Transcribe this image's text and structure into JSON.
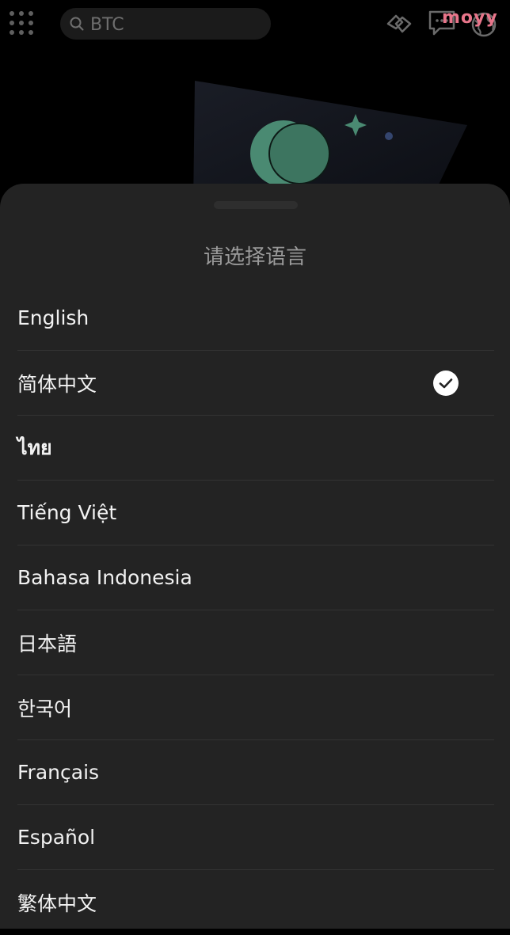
{
  "header": {
    "menu_icon": "grid-menu-icon",
    "search": {
      "value": "BTC",
      "icon": "search-icon"
    },
    "icons": [
      "handshake-icon",
      "message-icon",
      "globe-icon"
    ],
    "brand_text": "moyy",
    "brand_color": "#e8758a"
  },
  "hero": {
    "planet_color": "#4a8a72",
    "star_color": "#4a8a72"
  },
  "sheet": {
    "title": "请选择语言",
    "languages": [
      {
        "label": "English",
        "selected": false
      },
      {
        "label": "简体中文",
        "selected": true
      },
      {
        "label": "ไทย",
        "selected": false
      },
      {
        "label": "Tiếng Việt",
        "selected": false
      },
      {
        "label": "Bahasa Indonesia",
        "selected": false
      },
      {
        "label": "日本語",
        "selected": false
      },
      {
        "label": "한국어",
        "selected": false
      },
      {
        "label": "Français",
        "selected": false
      },
      {
        "label": "Español",
        "selected": false
      },
      {
        "label": "繁体中文",
        "selected": false
      }
    ],
    "selected_icon": "check-circle-icon"
  },
  "colors": {
    "background": "#000000",
    "sheet": "#232323",
    "divider": "#333333",
    "text": "#f2f2f2",
    "title": "#9a9a9a"
  }
}
